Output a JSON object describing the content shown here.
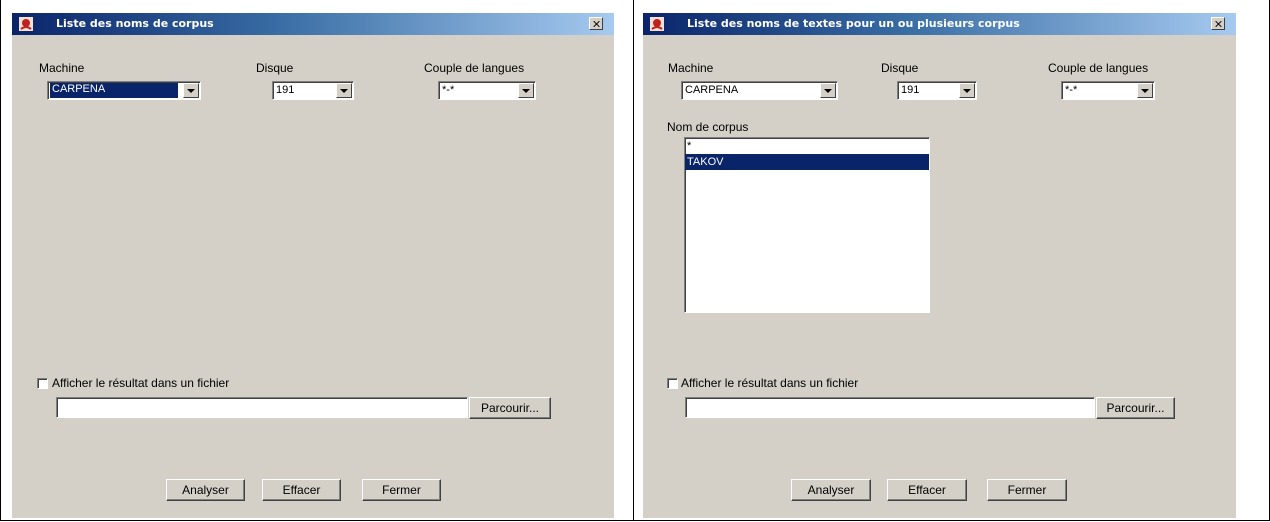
{
  "left_window": {
    "title": "Liste des noms de corpus",
    "machine_label": "Machine",
    "machine_value": "CARPENA",
    "disque_label": "Disque",
    "disque_value": "191",
    "couple_label": "Couple de langues",
    "couple_value": "*-*",
    "checkbox_label": "Afficher le résultat dans un fichier",
    "file_path": "",
    "browse_label": "Parcourir...",
    "analyser_label": "Analyser",
    "effacer_label": "Effacer",
    "fermer_label": "Fermer"
  },
  "right_window": {
    "title": "Liste des noms de textes pour un ou plusieurs corpus",
    "machine_label": "Machine",
    "machine_value": "CARPENA",
    "disque_label": "Disque",
    "disque_value": "191",
    "couple_label": "Couple de langues",
    "couple_value": "*-*",
    "corpus_label": "Nom de corpus",
    "corpus_items": [
      "*",
      "TAKOV"
    ],
    "checkbox_label": "Afficher le résultat dans un fichier",
    "file_path": "",
    "browse_label": "Parcourir...",
    "analyser_label": "Analyser",
    "effacer_label": "Effacer",
    "fermer_label": "Fermer"
  },
  "colors": {
    "title_gradient_start": "#0a246a",
    "title_gradient_end": "#a6caf0",
    "selection": "#0a246a",
    "dialog_bg": "#d4d0c8"
  }
}
